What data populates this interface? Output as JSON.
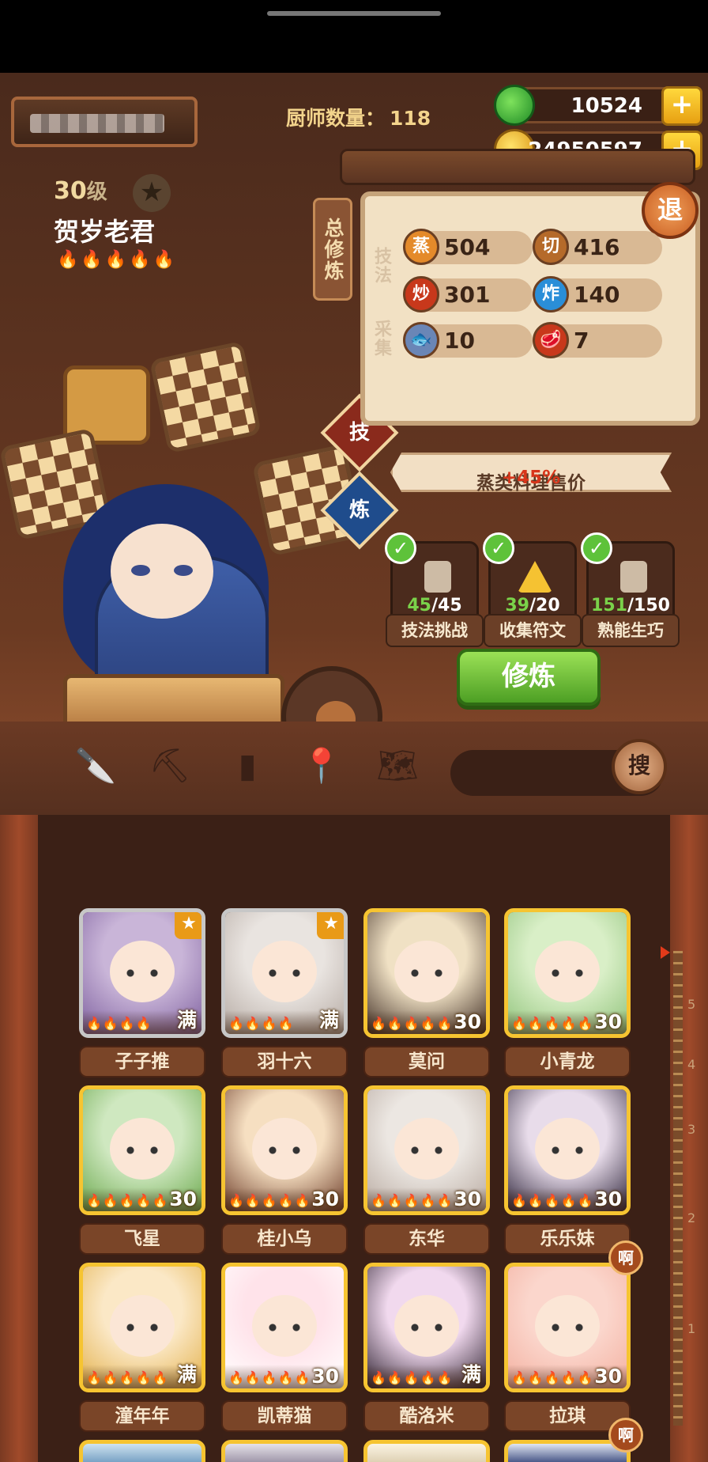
{
  "header": {
    "chef_count_label": "厨师数量：",
    "chef_count_value": "118",
    "jade": "10524",
    "coins": "24950597",
    "plus": "+",
    "exit": "退"
  },
  "chef": {
    "level": "30",
    "level_unit": "级",
    "name": "贺岁老君",
    "flames": "🔥🔥🔥🔥🔥"
  },
  "panel": {
    "tab_label": "总修炼",
    "skill_section": "技法",
    "gather_section": "采集",
    "stats": [
      {
        "icon": "蒸",
        "value": "504",
        "color": "#e48a2a"
      },
      {
        "icon": "切",
        "value": "416",
        "color": "#b56a2a"
      },
      {
        "icon": "炒",
        "value": "301",
        "color": "#c8381b"
      },
      {
        "icon": "炸",
        "value": "140",
        "color": "#2a8ed8"
      },
      {
        "icon": "fish-icon",
        "value": "10",
        "color": "#6a86b6"
      },
      {
        "icon": "meat-icon",
        "value": "7",
        "color": "#c8381b"
      }
    ],
    "skill_button": "技",
    "train_side_button": "炼",
    "bonus_text": "蒸类料理售价",
    "bonus_pct": "+45%",
    "tasks": [
      {
        "current": "45",
        "total": "/45",
        "label": "技法挑战"
      },
      {
        "current": "39",
        "total": "/20",
        "label": "收集符文"
      },
      {
        "current": "151",
        "total": "/150",
        "label": "熟能生巧"
      }
    ],
    "check": "✓",
    "train_button": "修炼"
  },
  "toolbar": {
    "search_button": "搜"
  },
  "ruler": [
    "5",
    "4",
    "3",
    "2",
    "1"
  ],
  "grid": {
    "star": "★",
    "ah": "啊",
    "cards": [
      {
        "name": "子子推",
        "level": "满",
        "flames": "🔥🔥🔥🔥"
      },
      {
        "name": "羽十六",
        "level": "满",
        "flames": "🔥🔥🔥🔥"
      },
      {
        "name": "莫问",
        "level": "30",
        "flames": "🔥🔥🔥🔥🔥"
      },
      {
        "name": "小青龙",
        "level": "30",
        "flames": "🔥🔥🔥🔥🔥"
      },
      {
        "name": "飞星",
        "level": "30",
        "flames": "🔥🔥🔥🔥🔥"
      },
      {
        "name": "桂小乌",
        "level": "30",
        "flames": "🔥🔥🔥🔥🔥"
      },
      {
        "name": "东华",
        "level": "30",
        "flames": "🔥🔥🔥🔥🔥"
      },
      {
        "name": "乐乐妹",
        "level": "30",
        "flames": "🔥🔥🔥🔥🔥"
      },
      {
        "name": "潼年年",
        "level": "满",
        "flames": "🔥🔥🔥🔥🔥"
      },
      {
        "name": "凯蒂猫",
        "level": "30",
        "flames": "🔥🔥🔥🔥🔥"
      },
      {
        "name": "酷洛米",
        "level": "满",
        "flames": "🔥🔥🔥🔥🔥"
      },
      {
        "name": "拉琪",
        "level": "30",
        "flames": "🔥🔥🔥🔥🔥"
      }
    ]
  }
}
